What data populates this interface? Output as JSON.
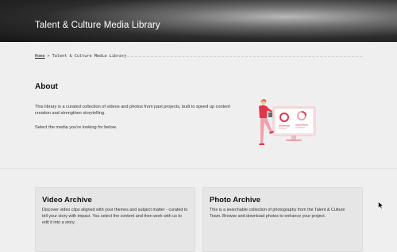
{
  "header": {
    "title": "Talent & Culture Media Library"
  },
  "breadcrumb": {
    "home": "Home",
    "separator": ">",
    "current": "Talent & Culture Media Library"
  },
  "about": {
    "title": "About",
    "description": "This library is a curated collection of videos and photos from past projects, built to speed up content creation and strengthen storytelling.",
    "prompt": "Select the media you're looking for below."
  },
  "cards": {
    "video": {
      "title": "Video Archive",
      "description": "Discover video clips aligned with your themes and subject matter - curated to tell your story with impact. You select the content and then work with us to edit it into a story."
    },
    "photo": {
      "title": "Photo Archive",
      "description": "This is a searchable collection of photography from the Talent & Culture Team. Browse and download photos to enhance your project."
    }
  },
  "colors": {
    "accent": "#e0364a",
    "accent_light": "#f7c9cf",
    "hero_dark": "#151515"
  },
  "icons": {
    "illustration": "woman-with-dashboard-illustration",
    "cursor": "mouse-pointer-icon"
  }
}
